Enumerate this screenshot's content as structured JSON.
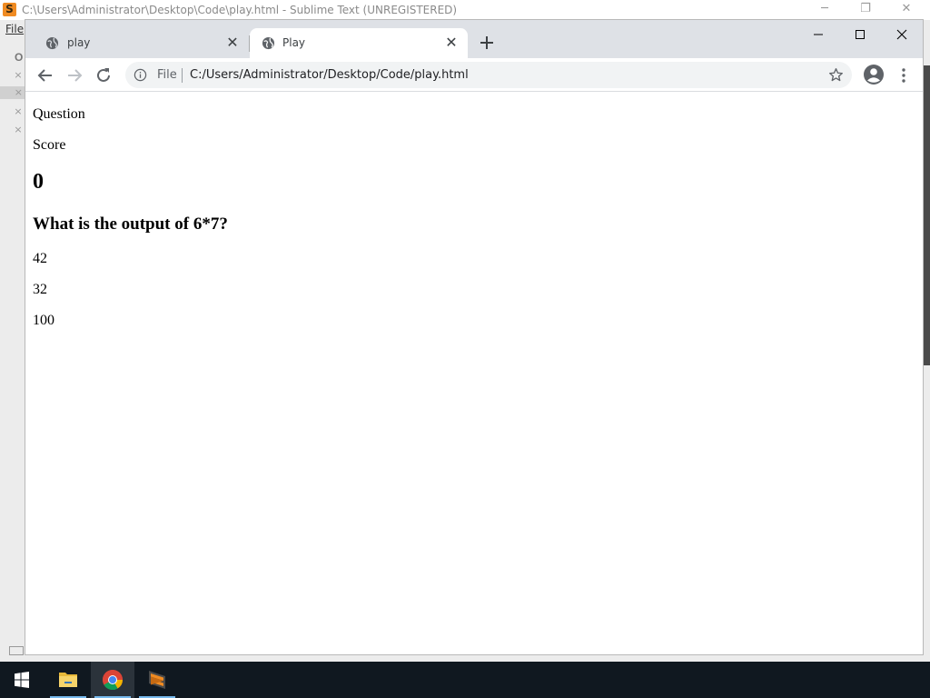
{
  "sublime": {
    "window_title": "C:\\Users\\Administrator\\Desktop\\Code\\play.html - Sublime Text (UNREGISTERED)",
    "logo_letter": "S",
    "menu_file": "File",
    "sidebar_letter": "O",
    "close_glyph": "×"
  },
  "chrome": {
    "tabs": [
      {
        "title": "play"
      },
      {
        "title": "Play"
      }
    ],
    "tab_close_glyph": "✕",
    "address": {
      "scheme_label": "File",
      "url": "C:/Users/Administrator/Desktop/Code/play.html"
    }
  },
  "page": {
    "question_label": "Question",
    "score_label": "Score",
    "score_value": "0",
    "question_text": "What is the output of 6*7?",
    "choices": [
      "42",
      "32",
      "100"
    ]
  },
  "colors": {
    "accent_blue": "#76b9ed",
    "sublime_orange": "#f08b22",
    "tabstrip": "#dee1e6",
    "taskbar": "#101820"
  }
}
